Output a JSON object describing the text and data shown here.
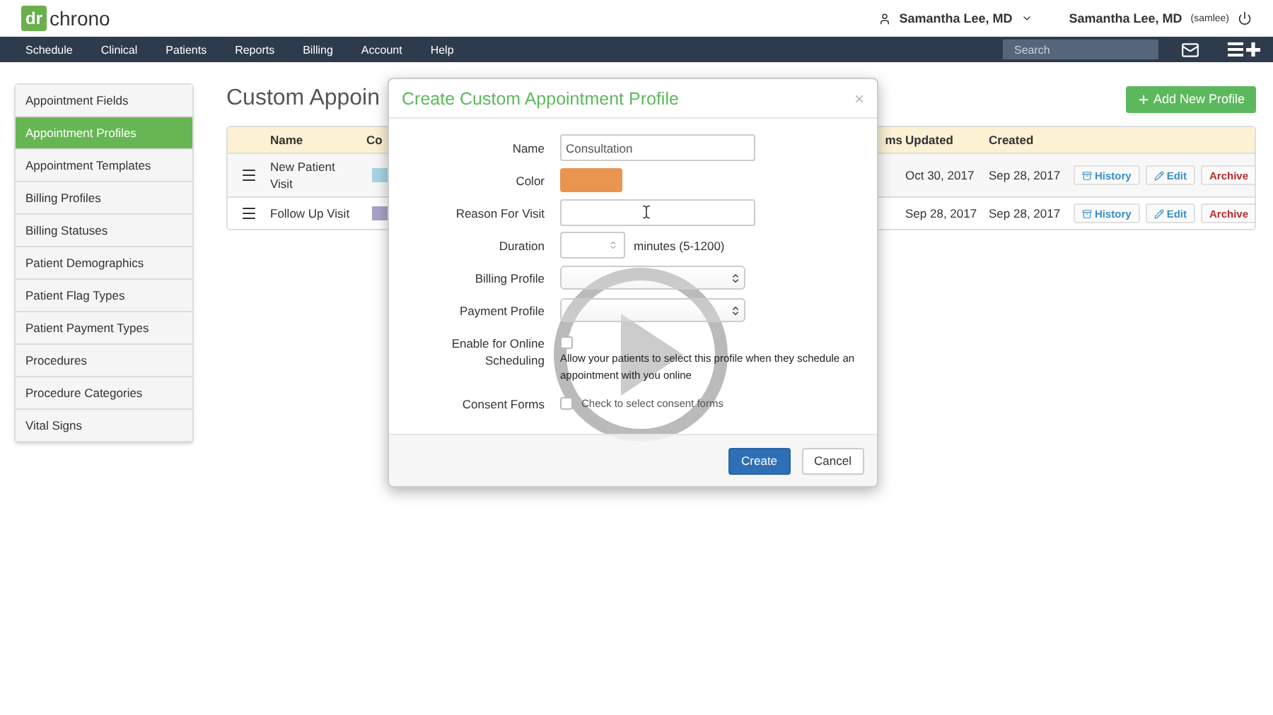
{
  "header": {
    "logo": {
      "mark": "dr",
      "name": "chrono"
    },
    "user_menu": "Samantha Lee, MD",
    "account": {
      "name": "Samantha Lee, MD",
      "username": "(samlee)"
    }
  },
  "nav": {
    "items": [
      "Schedule",
      "Clinical",
      "Patients",
      "Reports",
      "Billing",
      "Account",
      "Help"
    ],
    "search": {
      "placeholder": "Search"
    }
  },
  "sidebar": {
    "items": [
      {
        "label": "Appointment Fields",
        "selected": false
      },
      {
        "label": "Appointment Profiles",
        "selected": true
      },
      {
        "label": "Appointment Templates",
        "selected": false
      },
      {
        "label": "Billing Profiles",
        "selected": false
      },
      {
        "label": "Billing Statuses",
        "selected": false
      },
      {
        "label": "Patient Demographics",
        "selected": false
      },
      {
        "label": "Patient Flag Types",
        "selected": false
      },
      {
        "label": "Patient Payment Types",
        "selected": false
      },
      {
        "label": "Procedures",
        "selected": false
      },
      {
        "label": "Procedure Categories",
        "selected": false
      },
      {
        "label": "Vital Signs",
        "selected": false
      }
    ]
  },
  "page": {
    "title": "Custom Appoin",
    "add_button": "Add New Profile"
  },
  "table": {
    "columns": [
      "Name",
      "Co",
      "ms",
      "Updated",
      "Created"
    ],
    "rows": [
      {
        "name": "New Patient Visit",
        "color": "#a8d4e6",
        "updated": "Oct 30, 2017",
        "created": "Sep 28, 2017",
        "actions": [
          {
            "label": "History",
            "kind": "history"
          },
          {
            "label": "Edit",
            "kind": "edit"
          },
          {
            "label": "Archive",
            "kind": "archive"
          }
        ]
      },
      {
        "name": "Follow Up Visit",
        "color": "#a9a3c9",
        "updated": "Sep 28, 2017",
        "created": "Sep 28, 2017",
        "actions": [
          {
            "label": "History",
            "kind": "history"
          },
          {
            "label": "Edit",
            "kind": "edit"
          },
          {
            "label": "Archive",
            "kind": "archive"
          }
        ]
      }
    ]
  },
  "modal": {
    "title": "Create Custom Appointment Profile",
    "close": "×",
    "fields": [
      {
        "kind": "text",
        "label": "Name",
        "value": "Consultation"
      },
      {
        "kind": "color",
        "label": "Color",
        "color": "#e8954f"
      },
      {
        "kind": "text",
        "label": "Reason For Visit"
      },
      {
        "kind": "number",
        "label": "Duration",
        "suffix": "minutes (5-1200)"
      },
      {
        "kind": "select",
        "label": "Billing Profile"
      },
      {
        "kind": "select",
        "label": "Payment Profile"
      },
      {
        "kind": "checkbox",
        "label": "Enable for Online Scheduling",
        "checked": false,
        "help": "Allow your patients to select this profile when they schedule an appointment with you online"
      },
      {
        "kind": "inline_checkbox",
        "label": "Consent Forms",
        "checked": false,
        "text": "Check to select consent forms"
      }
    ],
    "buttons": [
      {
        "label": "Create",
        "kind": "primary"
      },
      {
        "label": "Cancel",
        "kind": "default"
      }
    ]
  }
}
